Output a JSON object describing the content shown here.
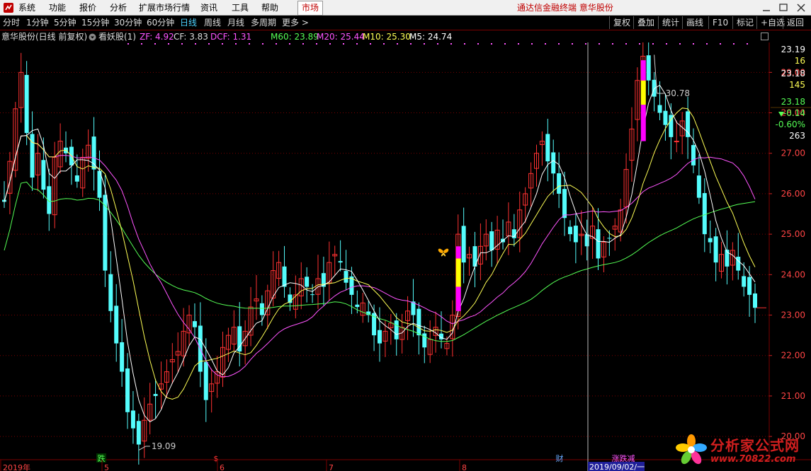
{
  "menu": {
    "items": [
      "系统",
      "功能",
      "报价",
      "分析",
      "扩展市场行情",
      "资讯",
      "工具",
      "帮助"
    ],
    "market_tab": "市场",
    "app_title": "通达信金融终端  意华股份"
  },
  "toolbar": {
    "timeframes": [
      "分时",
      "1分钟",
      "5分钟",
      "15分钟",
      "30分钟",
      "60分钟",
      "日线",
      "周线",
      "月线",
      "多周期",
      "更多 >"
    ],
    "active_timeframe": "日线",
    "right_buttons": [
      "复权",
      "叠加",
      "统计",
      "画线",
      "F10",
      "标记",
      "+自选",
      "返回"
    ]
  },
  "info": {
    "stock": "意华股份(日线 前复权)",
    "indicator": "看妖股(1)",
    "zf": "ZF: 4.92",
    "cf": "CF: 3.83",
    "dcf": "DCF: 1.31",
    "m60": "M60: 23.89",
    "m20": "M20: 25.44",
    "m10": "M10: 25.30",
    "m5": "M5: 24.74"
  },
  "right_panel": {
    "values": [
      "23.19",
      "16",
      "23.18",
      "145",
      "23.18",
      "-0.14",
      "-0.60%",
      "263"
    ],
    "change_arrow": "▼"
  },
  "axis": {
    "y_ticks": [
      "29.00",
      "28.00",
      "27.00",
      "26.00",
      "25.00",
      "24.00",
      "23.00",
      "22.00",
      "21.00",
      "20.00"
    ],
    "x_labels": [
      "2019年",
      "5",
      "6",
      "7",
      "8"
    ],
    "cursor_date": "2019/09/02/一"
  },
  "annotations": {
    "high_label": "30.78",
    "low_label": "19.09",
    "markers": [
      "跌",
      "$",
      "财",
      "涨跌减"
    ]
  },
  "watermark": {
    "title": "分析家公式网",
    "url": "www.70822.com"
  },
  "colors": {
    "up": "#ff3232",
    "down": "#54fcfc",
    "m5": "#ffffff",
    "m10": "#ffff55",
    "m20": "#ff55ff",
    "m60": "#55ff55",
    "grid": "#7a0000",
    "signal_magenta": "#ff00ff",
    "signal_yellow": "#ffff00"
  },
  "chart_data": {
    "type": "candlestick",
    "y_range": [
      19.6,
      29.6
    ],
    "y_axis_ticks": [
      29,
      28,
      27,
      26,
      25,
      24,
      23,
      22,
      21,
      20
    ],
    "high": 30.78,
    "low": 19.09,
    "last_close": 23.18,
    "series": [
      {
        "name": "M60",
        "last": 23.89
      },
      {
        "name": "M20",
        "last": 25.44
      },
      {
        "name": "M10",
        "last": 25.3
      },
      {
        "name": "M5",
        "last": 24.74
      }
    ],
    "closes": [
      25.8,
      26.8,
      28.1,
      29.0,
      27.5,
      26.4,
      27.0,
      26.1,
      25.5,
      26.9,
      27.3,
      27.0,
      26.7,
      26.3,
      26.9,
      27.2,
      26.6,
      25.9,
      24.1,
      23.1,
      22.3,
      21.6,
      20.6,
      20.2,
      19.8,
      20.4,
      20.8,
      21.0,
      21.3,
      21.6,
      21.9,
      22.1,
      22.6,
      23.0,
      22.7,
      21.6,
      20.9,
      21.3,
      21.6,
      22.2,
      22.5,
      22.7,
      22.1,
      22.6,
      23.2,
      23.4,
      23.0,
      23.6,
      24.1,
      24.3,
      23.7,
      23.3,
      23.5,
      23.9,
      23.7,
      23.5,
      23.9,
      23.7,
      24.3,
      24.5,
      24.3,
      23.8,
      23.5,
      23.2,
      23.3,
      23.0,
      22.5,
      22.3,
      22.6,
      22.8,
      22.4,
      22.7,
      23.1,
      23.0,
      22.5,
      22.2,
      22.4,
      22.7,
      22.4,
      22.3,
      23.0,
      25.0,
      24.3,
      24.5,
      24.2,
      24.7,
      25.0,
      24.6,
      25.1,
      24.8,
      25.3,
      24.9,
      25.6,
      26.0,
      26.5,
      27.0,
      27.3,
      26.8,
      26.5,
      26.0,
      25.4,
      25.0,
      24.8,
      25.0,
      24.7,
      25.2,
      24.4,
      24.8,
      24.9,
      25.2,
      25.6,
      26.6,
      27.6,
      28.8,
      29.4,
      28.8,
      28.4,
      28.0,
      27.7,
      27.4,
      27.3,
      27.8,
      27.4,
      26.7,
      25.9,
      25.0,
      24.8,
      24.3,
      24.5,
      24.2,
      24.6,
      24.1,
      23.7,
      23.5,
      23.18
    ]
  }
}
